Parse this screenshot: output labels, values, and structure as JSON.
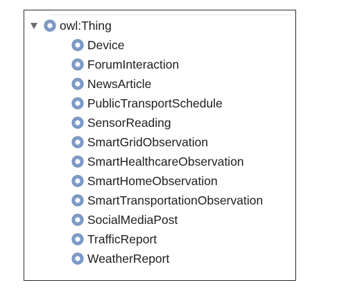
{
  "class_tree": {
    "root": {
      "label": "owl:Thing",
      "expanded": true,
      "toggle_icon": "triangle-down-icon",
      "icon": "owl-class-icon"
    },
    "children": [
      {
        "label": "Device",
        "icon": "owl-class-icon"
      },
      {
        "label": "ForumInteraction",
        "icon": "owl-class-icon"
      },
      {
        "label": "NewsArticle",
        "icon": "owl-class-icon"
      },
      {
        "label": "PublicTransportSchedule",
        "icon": "owl-class-icon"
      },
      {
        "label": "SensorReading",
        "icon": "owl-class-icon"
      },
      {
        "label": "SmartGridObservation",
        "icon": "owl-class-icon"
      },
      {
        "label": "SmartHealthcareObservation",
        "icon": "owl-class-icon"
      },
      {
        "label": "SmartHomeObservation",
        "icon": "owl-class-icon"
      },
      {
        "label": "SmartTransportationObservation",
        "icon": "owl-class-icon"
      },
      {
        "label": "SocialMediaPost",
        "icon": "owl-class-icon"
      },
      {
        "label": "TrafficReport",
        "icon": "owl-class-icon"
      },
      {
        "label": "WeatherReport",
        "icon": "owl-class-icon"
      }
    ]
  },
  "colors": {
    "class_icon_fill": "#7f9cc8",
    "class_icon_ring": "#6a87b4",
    "class_icon_center": "#ffffff",
    "toggle_color": "#6e6e6e",
    "text": "#1e1e1e",
    "border": "#2a2a2a"
  }
}
